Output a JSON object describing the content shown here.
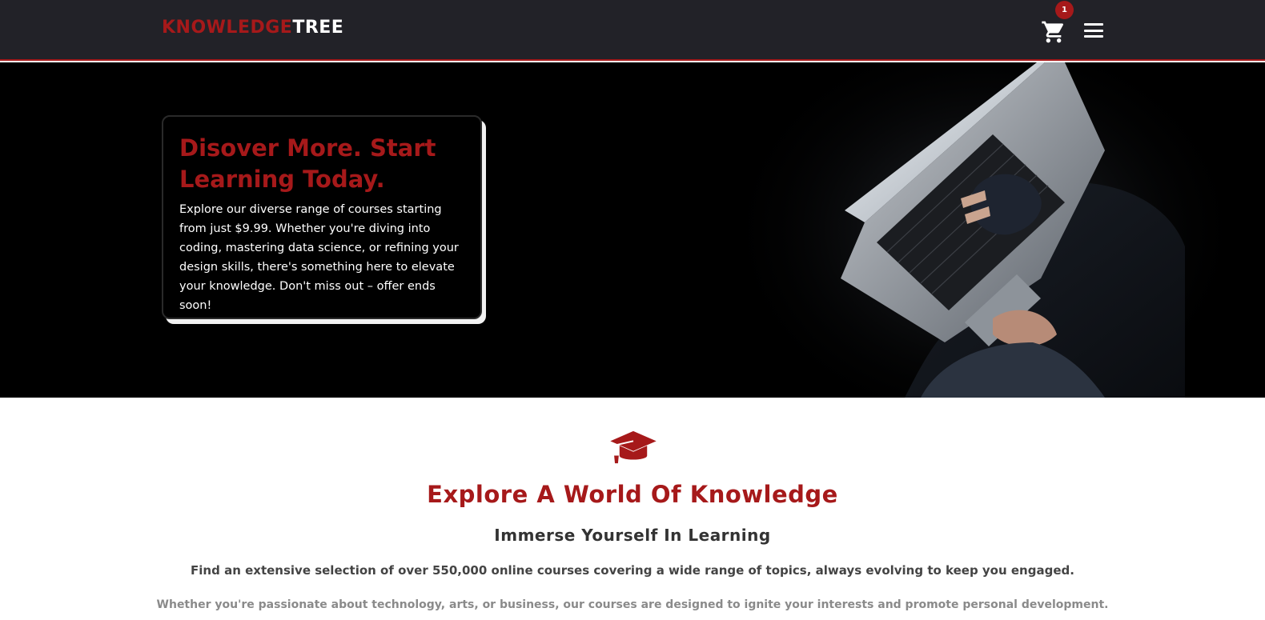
{
  "header": {
    "logo_part1": "KNOWLEDGE",
    "logo_part2": "TREE",
    "cart_count": "1",
    "cart_icon": "cart-icon",
    "menu_icon": "hamburger-icon"
  },
  "hero": {
    "title": "Disover More. Start Learning Today.",
    "text": "Explore our diverse range of courses starting from just $9.99. Whether you're diving into coding, mastering data science, or refining your design skills, there's something here to elevate your knowledge. Don't miss out – offer ends soon!"
  },
  "intro": {
    "icon": "graduation-cap-icon",
    "title": "Explore A World Of Knowledge",
    "subtitle": "Immerse Yourself In Learning",
    "paragraph1": "Find an extensive selection of over 550,000 online courses covering a wide range of topics, always evolving to keep you engaged.",
    "paragraph2": "Whether you're passionate about technology, arts, or business, our courses are designed to ignite your interests and promote personal development."
  },
  "colors": {
    "accent": "#a6191a",
    "header_bg": "#222228",
    "hero_bg": "#000000"
  }
}
